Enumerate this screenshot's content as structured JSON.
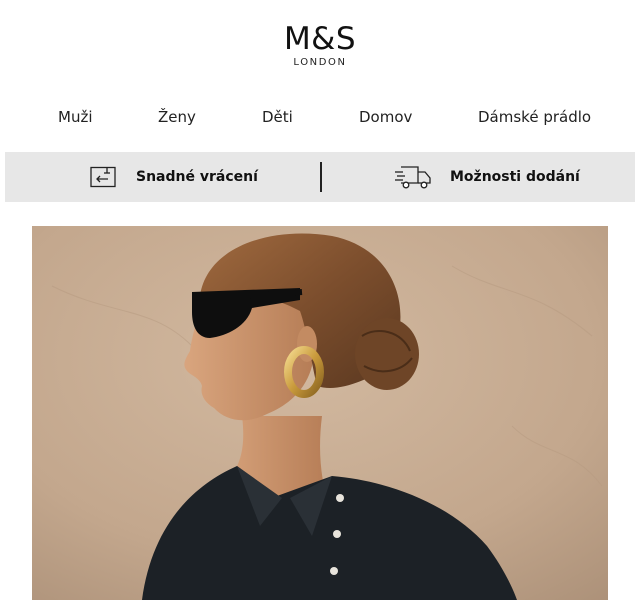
{
  "brand": {
    "name": "M&S",
    "sub": "LONDON"
  },
  "nav": {
    "items": [
      "Muži",
      "Ženy",
      "Děti",
      "Domov",
      "Dámské prádlo"
    ]
  },
  "services": {
    "returns_label": "Snadné vrácení",
    "delivery_label": "Možnosti dodání",
    "returns_icon": "return-box-icon",
    "delivery_icon": "delivery-truck-icon"
  },
  "hero": {
    "image": "woman-sunglasses-profile-photo"
  },
  "colors": {
    "service_bar_bg": "#e7e7e7",
    "text": "#111111",
    "hero_wall": "#c7ad93",
    "shirt": "#1c2126"
  }
}
